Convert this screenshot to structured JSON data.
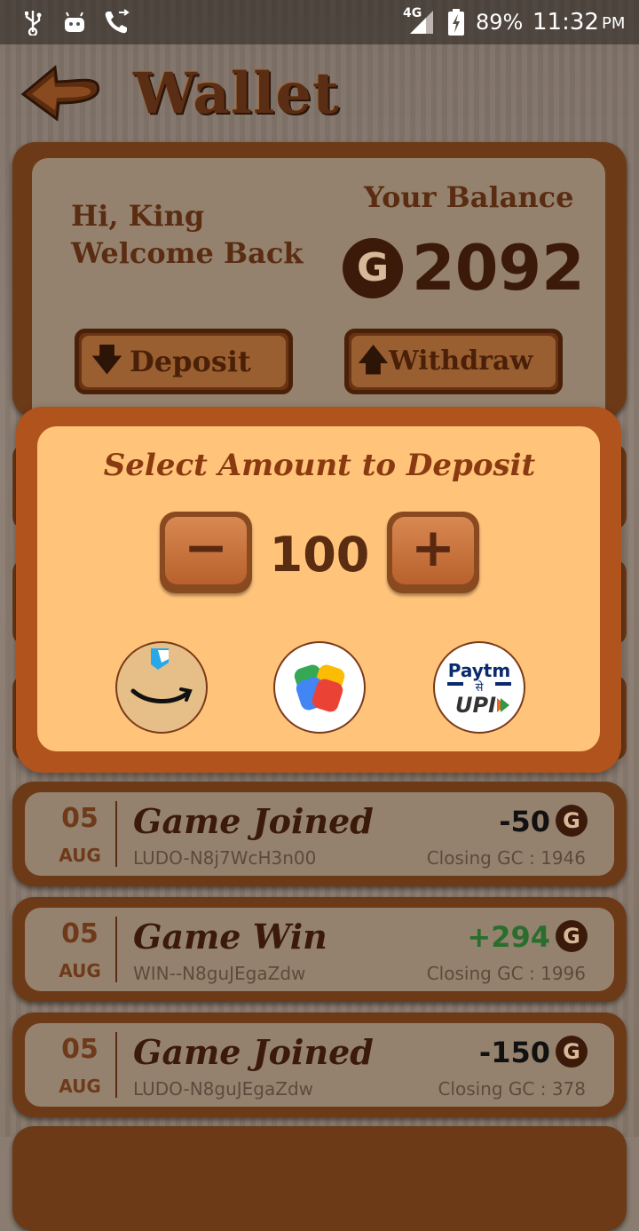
{
  "status_bar": {
    "battery": "89%",
    "time": "11:32",
    "ampm": "PM",
    "network": "4G",
    "icons": [
      "usb-icon",
      "android-icon",
      "call-forward-icon",
      "signal-icon",
      "battery-charging-icon"
    ]
  },
  "header": {
    "title": "Wallet",
    "back_icon": "back-arrow-icon"
  },
  "balance_card": {
    "greeting_line1": "Hi, King",
    "greeting_line2": "Welcome Back",
    "balance_label": "Your Balance",
    "coin_symbol": "G",
    "balance_value": "2092",
    "deposit_label": "Deposit",
    "withdraw_label": "Withdraw"
  },
  "deposit_dialog": {
    "title": "Select Amount to Deposit",
    "amount": "100",
    "minus_glyph": "−",
    "plus_glyph": "+",
    "payment_options": [
      {
        "name": "Amazon Pay",
        "icon": "amazon-pay-icon"
      },
      {
        "name": "Google Pay",
        "icon": "google-pay-icon"
      },
      {
        "name": "Paytm UPI",
        "icon": "paytm-upi-icon",
        "text_top": "Paytm",
        "text_mid": "से",
        "text_bottom": "UPI"
      }
    ]
  },
  "transactions": [
    {
      "day": "05",
      "month": "AUG",
      "title": "Game Joined",
      "ref": "LUDO-N8j7WcH3n00",
      "amount": "-50",
      "coin": "G",
      "closing": "Closing GC : 1946",
      "positive": false
    },
    {
      "day": "05",
      "month": "AUG",
      "title": "Game Win",
      "ref": "WIN--N8guJEgaZdw",
      "amount": "+294",
      "coin": "G",
      "closing": "Closing GC : 1996",
      "positive": true
    },
    {
      "day": "05",
      "month": "AUG",
      "title": "Game Joined",
      "ref": "LUDO-N8guJEgaZdw",
      "amount": "-150",
      "coin": "G",
      "closing": "Closing GC : 378",
      "positive": false
    }
  ],
  "colors": {
    "wood_dark": "#6d3a18",
    "panel": "#95826e",
    "dialog_bg": "#ffc37a",
    "positive": "#2a6e2e"
  }
}
